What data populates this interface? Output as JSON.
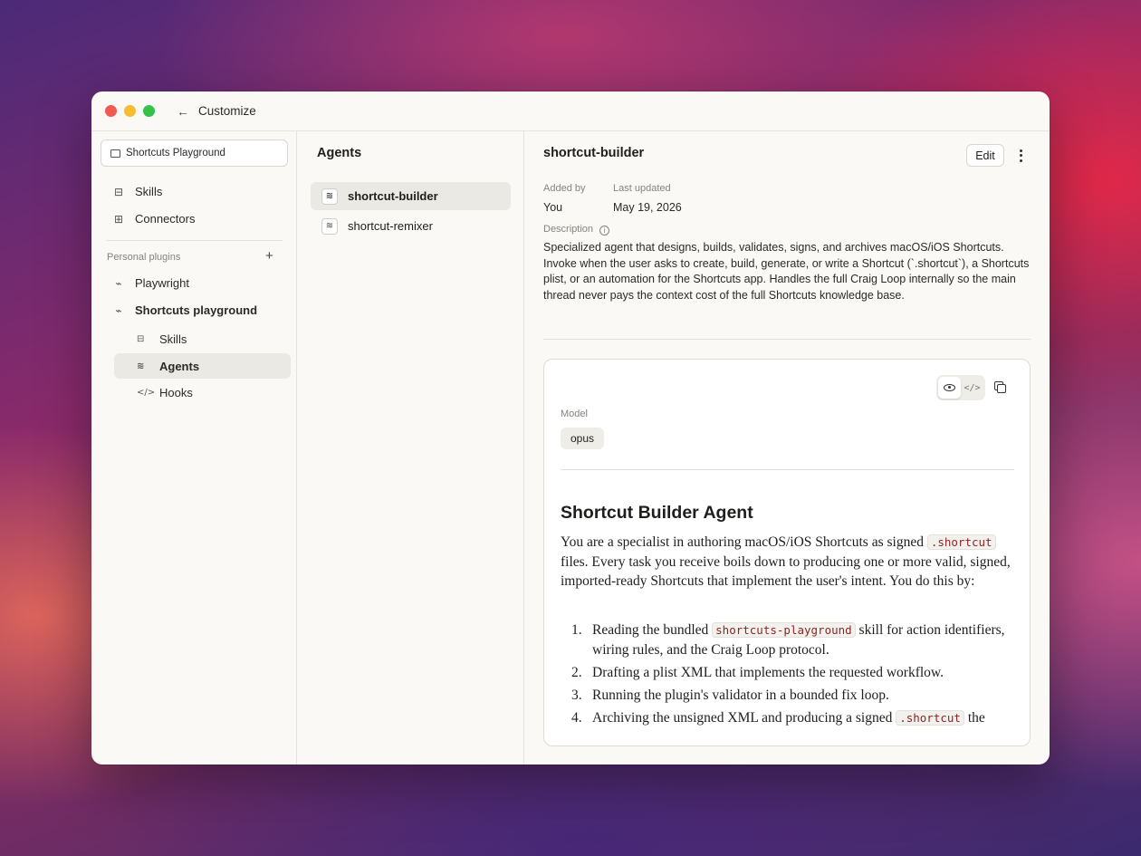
{
  "window": {
    "title": "Customize"
  },
  "sidebar": {
    "project": "Shortcuts Playground",
    "items": [
      {
        "label": "Skills",
        "icon": "skills-icon"
      },
      {
        "label": "Connectors",
        "icon": "connectors-icon"
      }
    ],
    "section_label": "Personal plugins",
    "plugins": [
      {
        "label": "Playwright",
        "icon": "plug-icon"
      },
      {
        "label": "Shortcuts playground",
        "icon": "plug-icon"
      }
    ],
    "sub_items": [
      {
        "label": "Skills",
        "icon": "skills-icon"
      },
      {
        "label": "Agents",
        "icon": "agents-icon",
        "active": true
      },
      {
        "label": "Hooks",
        "icon": "code-icon"
      }
    ]
  },
  "agents_panel": {
    "title": "Agents",
    "items": [
      {
        "label": "shortcut-builder",
        "active": true
      },
      {
        "label": "shortcut-remixer"
      }
    ]
  },
  "detail": {
    "title": "shortcut-builder",
    "edit_label": "Edit",
    "added_by_label": "Added by",
    "added_by_value": "You",
    "last_updated_label": "Last updated",
    "last_updated_value": "May 19, 2026",
    "description_label": "Description",
    "description": "Specialized agent that designs, builds, validates, signs, and archives macOS/iOS Shortcuts. Invoke when the user asks to create, build, generate, or write a Shortcut (`.shortcut`), a Shortcuts plist, or an automation for the Shortcuts app. Handles the full Craig Loop internally so the main thread never pays the context cost of the full Shortcuts knowledge base.",
    "model_label": "Model",
    "model_value": "opus",
    "md": {
      "heading": "Shortcut Builder Agent",
      "p1_a": "You are a specialist in authoring macOS/iOS Shortcuts as signed ",
      "p1_code": ".shortcut",
      "p1_b": " files. Every task you receive boils down to producing one or more valid, signed, imported-ready Shortcuts that implement the user's intent. You do this by:",
      "list": [
        {
          "num": "1.",
          "a": "Reading the bundled ",
          "code": "shortcuts-playground",
          "b": " skill for action identifiers, wiring rules, and the Craig Loop protocol."
        },
        {
          "num": "2.",
          "a": "Drafting a plist XML that implements the requested workflow."
        },
        {
          "num": "3.",
          "a": "Running the plugin's validator in a bounded fix loop."
        },
        {
          "num": "4.",
          "a": "Archiving the unsigned XML and producing a signed ",
          "code": ".shortcut",
          "b": " the"
        }
      ]
    }
  },
  "colors": {
    "window_bg": "#faf9f6",
    "active_bg": "#ebe9e4",
    "code_text": "#8b2626"
  }
}
